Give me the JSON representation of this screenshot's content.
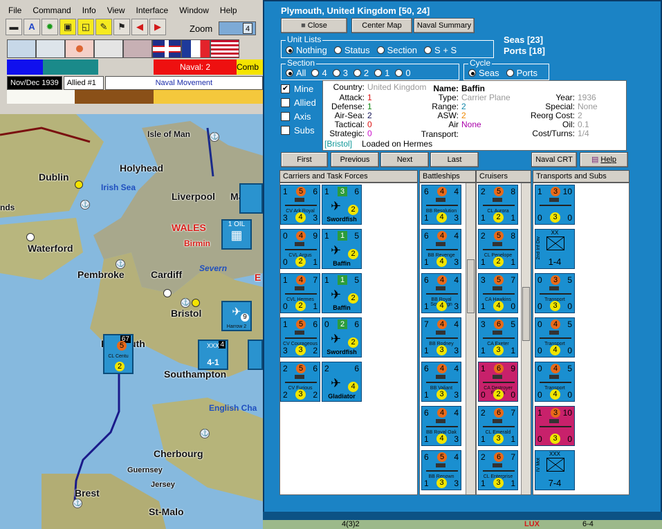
{
  "menu": [
    "File",
    "Command",
    "Info",
    "View",
    "Interface",
    "Window",
    "Help"
  ],
  "zoom": {
    "label": "Zoom",
    "value": "4"
  },
  "status": {
    "naval": "Naval: 2",
    "combat": "Comb",
    "date": "Nov/Dec 1939",
    "side": "Allied #1",
    "phase": "Naval Movement"
  },
  "map": {
    "places": [
      "Isle of Man",
      "Dublin",
      "Holyhead",
      "Irish Sea",
      "Liverpool",
      "Ma",
      "nds",
      "WALES",
      "Birmin",
      "Waterford",
      "Pembroke",
      "Cardiff",
      "Severn",
      "E",
      "Bristol",
      "Plymouth",
      "Southampton",
      "English Cha",
      "Cherbourg",
      "Guernsey",
      "Jersey",
      "Brest",
      "St-Malo"
    ],
    "counters": [
      {
        "top": "67",
        "mid": "5",
        "bot": "2",
        "label": "CL Centu"
      },
      {
        "top": "4",
        "mid": "XXX",
        "bot": "4-1",
        "label": "Plyme"
      },
      {
        "top": "1 OIL",
        "mid": "",
        "bot": "",
        "label": "oil"
      },
      {
        "top": "",
        "mid": "9",
        "bot": "",
        "label": "Harrow 2"
      }
    ]
  },
  "panel": {
    "title": "Plymouth, United Kingdom [50, 24]",
    "buttons": {
      "close": "Close",
      "center_map": "Center Map",
      "naval_summary": "Naval Summary",
      "first": "First",
      "previous": "Previous",
      "next": "Next",
      "last": "Last",
      "naval_crt": "Naval CRT",
      "help": "Help"
    },
    "unit_lists": {
      "title": "Unit Lists",
      "options": [
        "Nothing",
        "Status",
        "Section",
        "S + S"
      ],
      "selected": "Nothing"
    },
    "seas": "Seas [23]",
    "ports": "Ports [18]",
    "section": {
      "title": "Section",
      "options": [
        "All",
        "4",
        "3",
        "2",
        "1",
        "0"
      ],
      "selected": "All"
    },
    "cycle": {
      "title": "Cycle",
      "options": [
        "Seas",
        "Ports"
      ],
      "selected": "Seas"
    },
    "filters": [
      {
        "label": "Mine",
        "checked": true
      },
      {
        "label": "Allied",
        "checked": false
      },
      {
        "label": "Axis",
        "checked": false
      },
      {
        "label": "Subs",
        "checked": false
      }
    ],
    "info": {
      "country_label": "Country:",
      "country": "United Kingdom",
      "attack_label": "Attack:",
      "attack": "1",
      "defense_label": "Defense:",
      "defense": "1",
      "airsea_label": "Air-Sea:",
      "airsea": "2",
      "tactical_label": "Tactical:",
      "tactical": "0",
      "strategic_label": "Strategic:",
      "strategic": "0",
      "name_label": "Name:",
      "name": "Baffin",
      "type_label": "Type:",
      "type": "Carrier Plane",
      "range_label": "Range:",
      "range": "2",
      "asw_label": "ASW:",
      "asw": "2",
      "air_transport_label": "Air Transport:",
      "air_transport": "None",
      "year_label": "Year:",
      "year": "1936",
      "special_label": "Special:",
      "special": "None",
      "reorg_label": "Reorg Cost:",
      "reorg": "2",
      "oil_label": "Oil:",
      "oil": "0.1",
      "cost_label": "Cost/Turns:",
      "cost": "1/4",
      "location": "[Bristol]",
      "loaded": "Loaded on Hermes"
    },
    "sections": [
      "Carriers and Task Forces",
      "Battleships",
      "Cruisers",
      "Transports and Subs"
    ],
    "carriers": [
      {
        "tl": "1",
        "att": "5",
        "tr": "6",
        "bl": "3",
        "cap": "4",
        "br": "3",
        "name": "CV Ark Royal"
      },
      {
        "tl": "0",
        "att": "4",
        "tr": "9",
        "bl": "0",
        "cap": "2",
        "br": "1",
        "name": "CVL Argus"
      },
      {
        "tl": "1",
        "att": "4",
        "tr": "7",
        "bl": "0",
        "cap": "2",
        "br": "1",
        "name": "CVL Hermes"
      },
      {
        "tl": "1",
        "att": "5",
        "tr": "6",
        "bl": "3",
        "cap": "3",
        "br": "2",
        "name": "CV Courageous"
      },
      {
        "tl": "2",
        "att": "5",
        "tr": "6",
        "bl": "2",
        "cap": "3",
        "br": "2",
        "name": "CV Furious"
      }
    ],
    "planes": [
      {
        "tl": "1",
        "top": "3",
        "tr": "6",
        "cap": "2",
        "name": "Swordfish"
      },
      {
        "tl": "1",
        "top": "1",
        "tr": "5",
        "cap": "2",
        "name": "Baffin"
      },
      {
        "tl": "1",
        "top": "1",
        "tr": "5",
        "cap": "2",
        "name": "Baffin"
      },
      {
        "tl": "0",
        "top": "2",
        "tr": "6",
        "cap": "2",
        "name": "Swordfish"
      },
      {
        "tl": "2",
        "top": "",
        "tr": "6",
        "cap": "4",
        "name": "Gladiator"
      }
    ],
    "battleships": [
      {
        "tl": "6",
        "att": "4",
        "tr": "4",
        "bl": "1",
        "cap": "4",
        "br": "3",
        "name": "BB Resolution"
      },
      {
        "tl": "6",
        "att": "4",
        "tr": "4",
        "bl": "1",
        "cap": "4",
        "br": "3",
        "name": "BB Revenge"
      },
      {
        "tl": "6",
        "att": "4",
        "tr": "4",
        "bl": "1",
        "cap": "4",
        "br": "3",
        "name": "BB Royal Sovereign"
      },
      {
        "tl": "7",
        "att": "4",
        "tr": "4",
        "bl": "1",
        "cap": "3",
        "br": "3",
        "name": "BB Rodney"
      },
      {
        "tl": "6",
        "att": "4",
        "tr": "4",
        "bl": "1",
        "cap": "3",
        "br": "3",
        "name": "BB Valiant"
      },
      {
        "tl": "6",
        "att": "4",
        "tr": "4",
        "bl": "1",
        "cap": "4",
        "br": "3",
        "name": "BB Royal Oak"
      },
      {
        "tl": "6",
        "att": "5",
        "tr": "4",
        "bl": "1",
        "cap": "3",
        "br": "3",
        "name": "BB Renown"
      }
    ],
    "cruisers": [
      {
        "tl": "2",
        "att": "5",
        "tr": "8",
        "bl": "1",
        "cap": "2",
        "br": "1",
        "name": "CL Aurora",
        "red": false
      },
      {
        "tl": "2",
        "att": "5",
        "tr": "8",
        "bl": "1",
        "cap": "2",
        "br": "1",
        "name": "CL Penelope",
        "red": false
      },
      {
        "tl": "3",
        "att": "5",
        "tr": "7",
        "bl": "1",
        "cap": "4",
        "br": "0",
        "name": "CA Hawkins",
        "red": false
      },
      {
        "tl": "3",
        "att": "6",
        "tr": "5",
        "bl": "1",
        "cap": "3",
        "br": "1",
        "name": "CA Exeter",
        "red": false
      },
      {
        "tl": "1",
        "att": "6",
        "tr": "9",
        "bl": "0",
        "cap": "2",
        "br": "0",
        "name": "CA Destroyer Flotilla",
        "red": true
      },
      {
        "tl": "2",
        "att": "6",
        "tr": "7",
        "bl": "1",
        "cap": "3",
        "br": "1",
        "name": "CL Emerald",
        "red": false
      },
      {
        "tl": "2",
        "att": "6",
        "tr": "7",
        "bl": "1",
        "cap": "3",
        "br": "1",
        "name": "CL Enterprise",
        "red": false
      }
    ],
    "transports": [
      {
        "tl": "1",
        "att": "3",
        "tr": "10",
        "bl": "0",
        "cap": "3",
        "br": "0",
        "name": "",
        "kind": "ship",
        "red": false
      },
      {
        "tl": "",
        "att": "XX",
        "tr": "",
        "bl": "",
        "cap": "1-4",
        "br": "",
        "name": "2nd Inf Div",
        "kind": "inf",
        "red": false
      },
      {
        "tl": "0",
        "att": "3",
        "tr": "5",
        "bl": "0",
        "cap": "3",
        "br": "0",
        "name": "Transport",
        "kind": "ship",
        "red": false
      },
      {
        "tl": "0",
        "att": "4",
        "tr": "5",
        "bl": "0",
        "cap": "4",
        "br": "0",
        "name": "Transport",
        "kind": "ship",
        "red": false
      },
      {
        "tl": "0",
        "att": "4",
        "tr": "5",
        "bl": "0",
        "cap": "4",
        "br": "0",
        "name": "Transport",
        "kind": "ship",
        "red": false
      },
      {
        "tl": "1",
        "att": "3",
        "tr": "10",
        "bl": "0",
        "cap": "3",
        "br": "0",
        "name": "",
        "kind": "ship",
        "red": true
      },
      {
        "tl": "",
        "att": "XXX",
        "tr": "",
        "bl": "",
        "cap": "7-4",
        "br": "",
        "name": "IV Mot",
        "kind": "inf",
        "red": false
      }
    ]
  },
  "colors": {
    "panel_bg": "#1b83c5",
    "counter_blue": "#1a8fd0",
    "counter_red": "#c8216b",
    "highlight_green": "#2c9c3c"
  },
  "bottom_left": {
    "a": "4(3)2",
    "b": "LUX",
    "c": "6-4"
  }
}
